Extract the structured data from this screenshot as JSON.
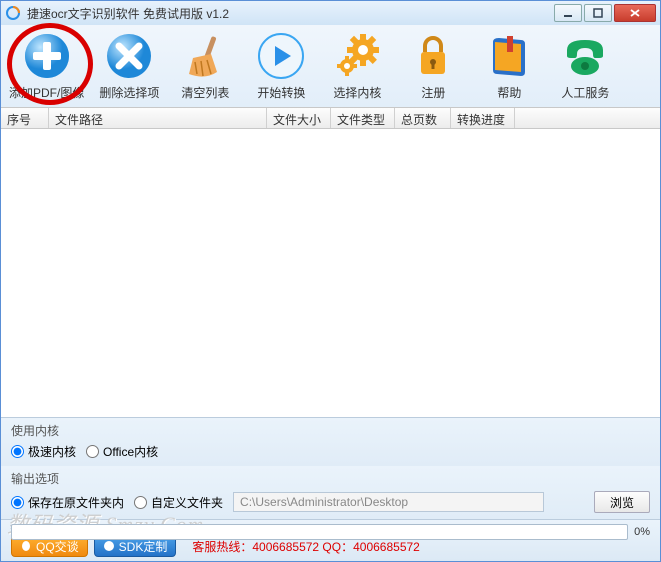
{
  "window": {
    "title": "捷速ocr文字识别软件 免费试用版 v1.2"
  },
  "toolbar": {
    "add": "添加PDF/图像",
    "remove": "删除选择项",
    "clear": "清空列表",
    "start": "开始转换",
    "engine": "选择内核",
    "register": "注册",
    "help": "帮助",
    "service": "人工服务"
  },
  "columns": {
    "c0": "序号",
    "c1": "文件路径",
    "c2": "文件大小",
    "c3": "文件类型",
    "c4": "总页数",
    "c5": "转换进度"
  },
  "engine_section": {
    "label": "使用内核",
    "opt_fast": "极速内核",
    "opt_office": "Office内核"
  },
  "output_section": {
    "label": "输出选项",
    "opt_same": "保存在原文件夹内",
    "opt_custom": "自定义文件夹",
    "path": "C:\\Users\\Administrator\\Desktop",
    "browse": "浏览"
  },
  "bottom": {
    "qq_btn": "QQ交谈",
    "sdk_btn": "SDK定制",
    "hotline": "客服热线：4006685572 QQ：4006685572",
    "percent": "0%"
  },
  "watermark": "数码资源 Smzy.Com"
}
